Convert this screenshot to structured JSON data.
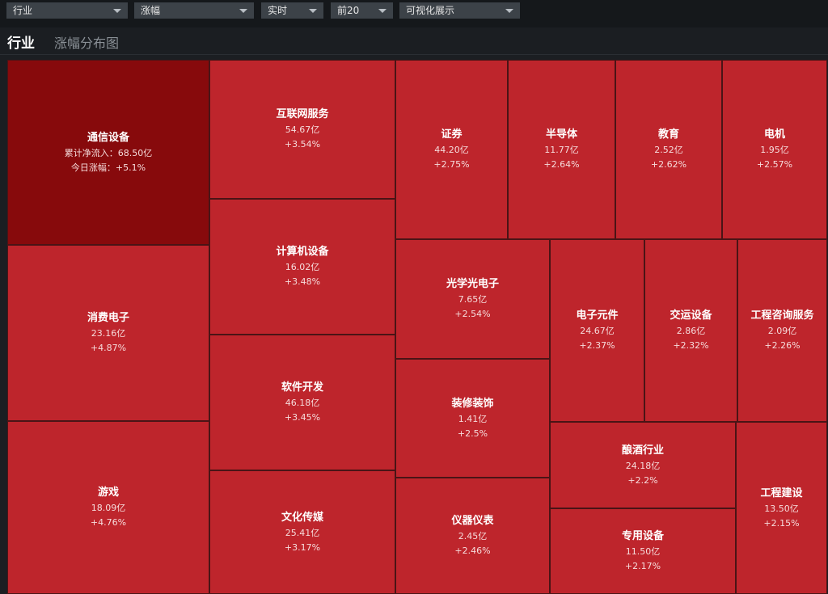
{
  "toolbar": {
    "filters": [
      {
        "label": "行业"
      },
      {
        "label": "涨幅"
      },
      {
        "label": "实时"
      },
      {
        "label": "前20"
      },
      {
        "label": "可视化展示"
      }
    ]
  },
  "header": {
    "title": "行业",
    "subtitle": "涨幅分布图"
  },
  "colors": {
    "top_tile": "#870a0c",
    "tile": "#be252c",
    "border": "#4a1416"
  },
  "tiles": [
    {
      "name": "通信设备",
      "value": "累计净流入：68.50亿",
      "pct": "今日涨幅：+5.1%"
    },
    {
      "name": "消费电子",
      "value": "23.16亿",
      "pct": "+4.87%"
    },
    {
      "name": "游戏",
      "value": "18.09亿",
      "pct": "+4.76%"
    },
    {
      "name": "互联网服务",
      "value": "54.67亿",
      "pct": "+3.54%"
    },
    {
      "name": "计算机设备",
      "value": "16.02亿",
      "pct": "+3.48%"
    },
    {
      "name": "软件开发",
      "value": "46.18亿",
      "pct": "+3.45%"
    },
    {
      "name": "文化传媒",
      "value": "25.41亿",
      "pct": "+3.17%"
    },
    {
      "name": "证券",
      "value": "44.20亿",
      "pct": "+2.75%"
    },
    {
      "name": "半导体",
      "value": "11.77亿",
      "pct": "+2.64%"
    },
    {
      "name": "教育",
      "value": "2.52亿",
      "pct": "+2.62%"
    },
    {
      "name": "电机",
      "value": "1.95亿",
      "pct": "+2.57%"
    },
    {
      "name": "光学光电子",
      "value": "7.65亿",
      "pct": "+2.54%"
    },
    {
      "name": "装修装饰",
      "value": "1.41亿",
      "pct": "+2.5%"
    },
    {
      "name": "仪器仪表",
      "value": "2.45亿",
      "pct": "+2.46%"
    },
    {
      "name": "电子元件",
      "value": "24.67亿",
      "pct": "+2.37%"
    },
    {
      "name": "交运设备",
      "value": "2.86亿",
      "pct": "+2.32%"
    },
    {
      "name": "工程咨询服务",
      "value": "2.09亿",
      "pct": "+2.26%"
    },
    {
      "name": "酿酒行业",
      "value": "24.18亿",
      "pct": "+2.2%"
    },
    {
      "name": "专用设备",
      "value": "11.50亿",
      "pct": "+2.17%"
    },
    {
      "name": "工程建设",
      "value": "13.50亿",
      "pct": "+2.15%"
    }
  ]
}
